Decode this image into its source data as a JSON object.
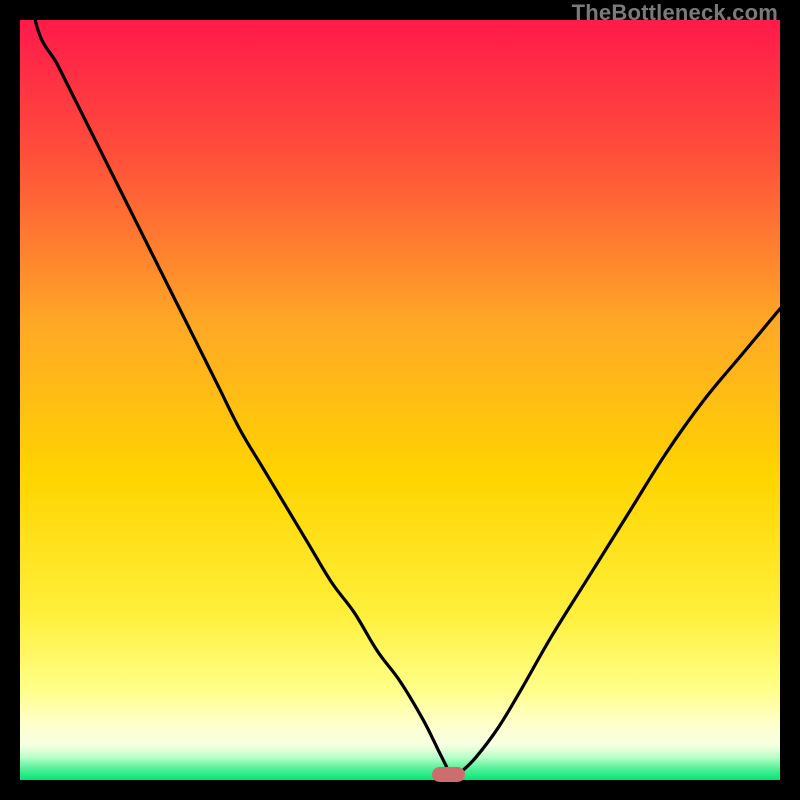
{
  "watermark": "TheBottleneck.com",
  "colors": {
    "gradient_top": "#ff1a4b",
    "gradient_upper_mid": "#ff7a2e",
    "gradient_mid": "#ffd400",
    "gradient_lower_mid": "#ffff66",
    "gradient_pale": "#ffffcc",
    "gradient_bottom": "#00e676",
    "curve": "#000000",
    "marker": "#cc6f6c",
    "background": "#000000"
  },
  "chart_data": {
    "type": "line",
    "title": "",
    "xlabel": "",
    "ylabel": "",
    "xlim": [
      0,
      100
    ],
    "ylim": [
      0,
      100
    ],
    "grid": false,
    "legend": false,
    "note": "Single V-shaped bottleneck curve; y is bottleneck % (0 = ideal / green), minimum near x≈57",
    "x": [
      0,
      2,
      5,
      8,
      11,
      14,
      17,
      20,
      23,
      26,
      29,
      32,
      35,
      38,
      41,
      44,
      47,
      50,
      53,
      55,
      56,
      57,
      58,
      60,
      63,
      66,
      70,
      75,
      80,
      85,
      90,
      95,
      100
    ],
    "values": [
      115,
      100,
      94,
      88,
      82,
      76,
      70,
      64,
      58,
      52,
      46,
      41,
      36,
      31,
      26,
      22,
      17,
      13,
      8,
      4,
      2,
      0,
      1,
      3,
      7,
      12,
      19,
      27,
      35,
      43,
      50,
      56,
      62
    ],
    "optimum_x": 57,
    "marker": {
      "x_start": 54.2,
      "x_end": 58.5,
      "y": 0
    }
  }
}
